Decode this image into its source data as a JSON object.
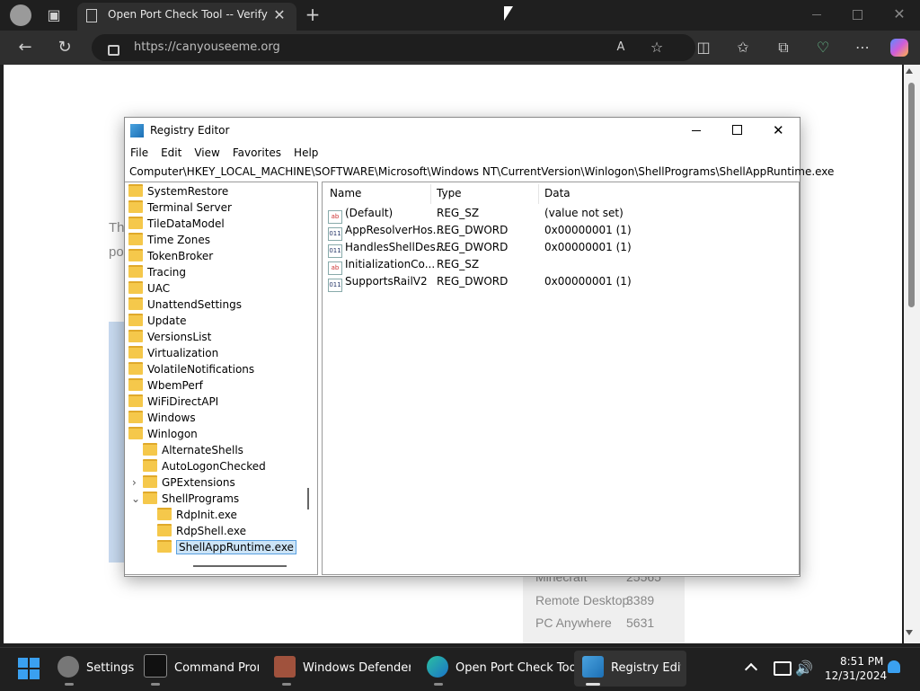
{
  "browser": {
    "tab_title": "Open Port Check Tool -- Verify Po",
    "url": "https://canyouseeme.org",
    "icons": [
      "profile-icon",
      "tab-actions-icon",
      "close-icon",
      "new-tab-icon",
      "back-icon",
      "refresh-icon",
      "lock-icon",
      "read-aloud-icon",
      "favorite-icon",
      "split-screen-icon",
      "favorites-icon",
      "collections-icon",
      "performance-icon",
      "more-icon",
      "copilot-icon"
    ]
  },
  "webpage": {
    "partial_text_1": "Th",
    "partial_text_2": "po",
    "ports": [
      {
        "name": "Minecraft",
        "port": "25565"
      },
      {
        "name": "Remote Desktop",
        "port": "3389"
      },
      {
        "name": "PC Anywhere",
        "port": "5631"
      }
    ]
  },
  "registry": {
    "title": "Registry Editor",
    "menu": [
      "File",
      "Edit",
      "View",
      "Favorites",
      "Help"
    ],
    "path": "Computer\\HKEY_LOCAL_MACHINE\\SOFTWARE\\Microsoft\\Windows NT\\CurrentVersion\\Winlogon\\ShellPrograms\\ShellAppRuntime.exe",
    "tree": [
      {
        "label": "SystemRestore"
      },
      {
        "label": "Terminal Server"
      },
      {
        "label": "TileDataModel"
      },
      {
        "label": "Time Zones"
      },
      {
        "label": "TokenBroker"
      },
      {
        "label": "Tracing"
      },
      {
        "label": "UAC"
      },
      {
        "label": "UnattendSettings"
      },
      {
        "label": "Update"
      },
      {
        "label": "VersionsList"
      },
      {
        "label": "Virtualization"
      },
      {
        "label": "VolatileNotifications"
      },
      {
        "label": "WbemPerf"
      },
      {
        "label": "WiFiDirectAPI"
      },
      {
        "label": "Windows"
      },
      {
        "label": "Winlogon"
      },
      {
        "label": "AlternateShells"
      },
      {
        "label": "AutoLogonChecked"
      },
      {
        "label": "GPExtensions"
      },
      {
        "label": "ShellPrograms"
      },
      {
        "label": "RdpInit.exe"
      },
      {
        "label": "RdpShell.exe"
      },
      {
        "label": "ShellAppRuntime.exe"
      }
    ],
    "columns": {
      "name": "Name",
      "type": "Type",
      "data": "Data"
    },
    "values": [
      {
        "icon": "ab",
        "name": "(Default)",
        "type": "REG_SZ",
        "data": "(value not set)"
      },
      {
        "icon": "011",
        "name": "AppResolverHos...",
        "type": "REG_DWORD",
        "data": "0x00000001 (1)"
      },
      {
        "icon": "011",
        "name": "HandlesShellDes...",
        "type": "REG_DWORD",
        "data": "0x00000001 (1)"
      },
      {
        "icon": "ab",
        "name": "InitializationCo...",
        "type": "REG_SZ",
        "data": ""
      },
      {
        "icon": "011",
        "name": "SupportsRailV2",
        "type": "REG_DWORD",
        "data": "0x00000001 (1)"
      }
    ]
  },
  "taskbar": {
    "apps": [
      "Settings",
      "Command Promp",
      "Windows Defender Fir",
      "Open Port Check Tool",
      "Registry Edito"
    ],
    "time": "8:51 PM",
    "date": "12/31/2024"
  },
  "colors": {
    "accent": "#0078d4",
    "folder": "#f5c84b",
    "selection": "#cce4f7"
  }
}
